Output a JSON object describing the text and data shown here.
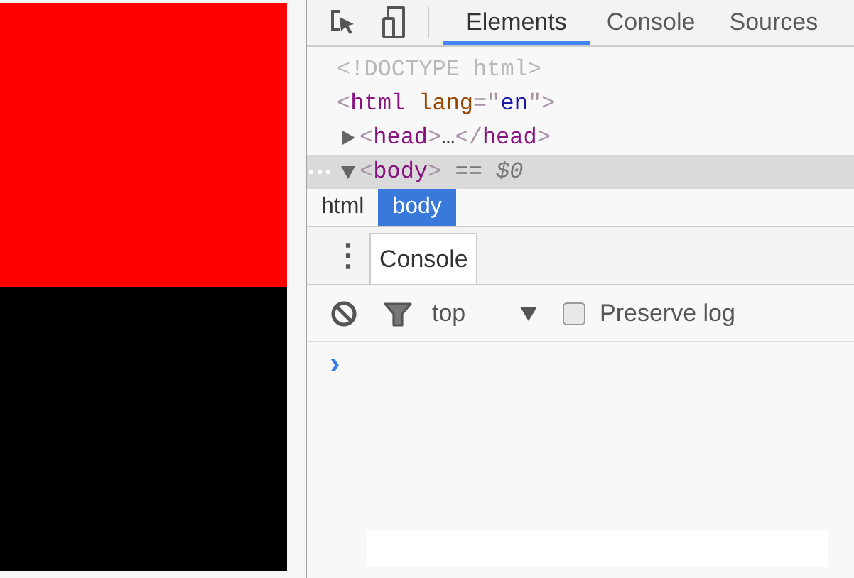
{
  "page_preview": {
    "blocks": [
      {
        "color": "#ff0000"
      },
      {
        "color": "#000000"
      }
    ]
  },
  "toolbar": {
    "tabs": [
      {
        "label": "Elements",
        "selected": true
      },
      {
        "label": "Console",
        "selected": false
      },
      {
        "label": "Sources",
        "selected": false
      }
    ]
  },
  "dom_tree": [
    {
      "selected": false,
      "parts": [
        {
          "kind": "doctype",
          "text": "<!DOCTYPE html>"
        }
      ]
    },
    {
      "selected": false,
      "parts": [
        {
          "kind": "punct",
          "text": "<"
        },
        {
          "kind": "tag",
          "text": "html"
        },
        {
          "kind": "attr",
          "text": " lang"
        },
        {
          "kind": "punct",
          "text": "=\""
        },
        {
          "kind": "value",
          "text": "en"
        },
        {
          "kind": "punct",
          "text": "\">"
        }
      ],
      "children": [
        {
          "selected": false,
          "expanded": false,
          "parts": [
            {
              "kind": "punct",
              "text": "<"
            },
            {
              "kind": "tag",
              "text": "head"
            },
            {
              "kind": "punct",
              "text": ">"
            },
            {
              "kind": "plain",
              "text": "…"
            },
            {
              "kind": "punct",
              "text": "</"
            },
            {
              "kind": "tag",
              "text": "head"
            },
            {
              "kind": "punct",
              "text": ">"
            }
          ]
        },
        {
          "selected": true,
          "expanded": true,
          "parts": [
            {
              "kind": "punct",
              "text": "<"
            },
            {
              "kind": "tag",
              "text": "body"
            },
            {
              "kind": "punct",
              "text": ">"
            },
            {
              "kind": "ref",
              "text": " == $0"
            }
          ]
        }
      ]
    }
  ],
  "breadcrumbs": [
    {
      "label": "html",
      "selected": false
    },
    {
      "label": "body",
      "selected": true
    }
  ],
  "drawer": {
    "menu_icon": "⋮",
    "tabs": [
      {
        "label": "Console",
        "selected": true
      }
    ]
  },
  "console_toolbar": {
    "context": "top",
    "preserve_log": {
      "label": "Preserve log",
      "checked": false
    }
  },
  "console": {
    "prompt": "›"
  }
}
